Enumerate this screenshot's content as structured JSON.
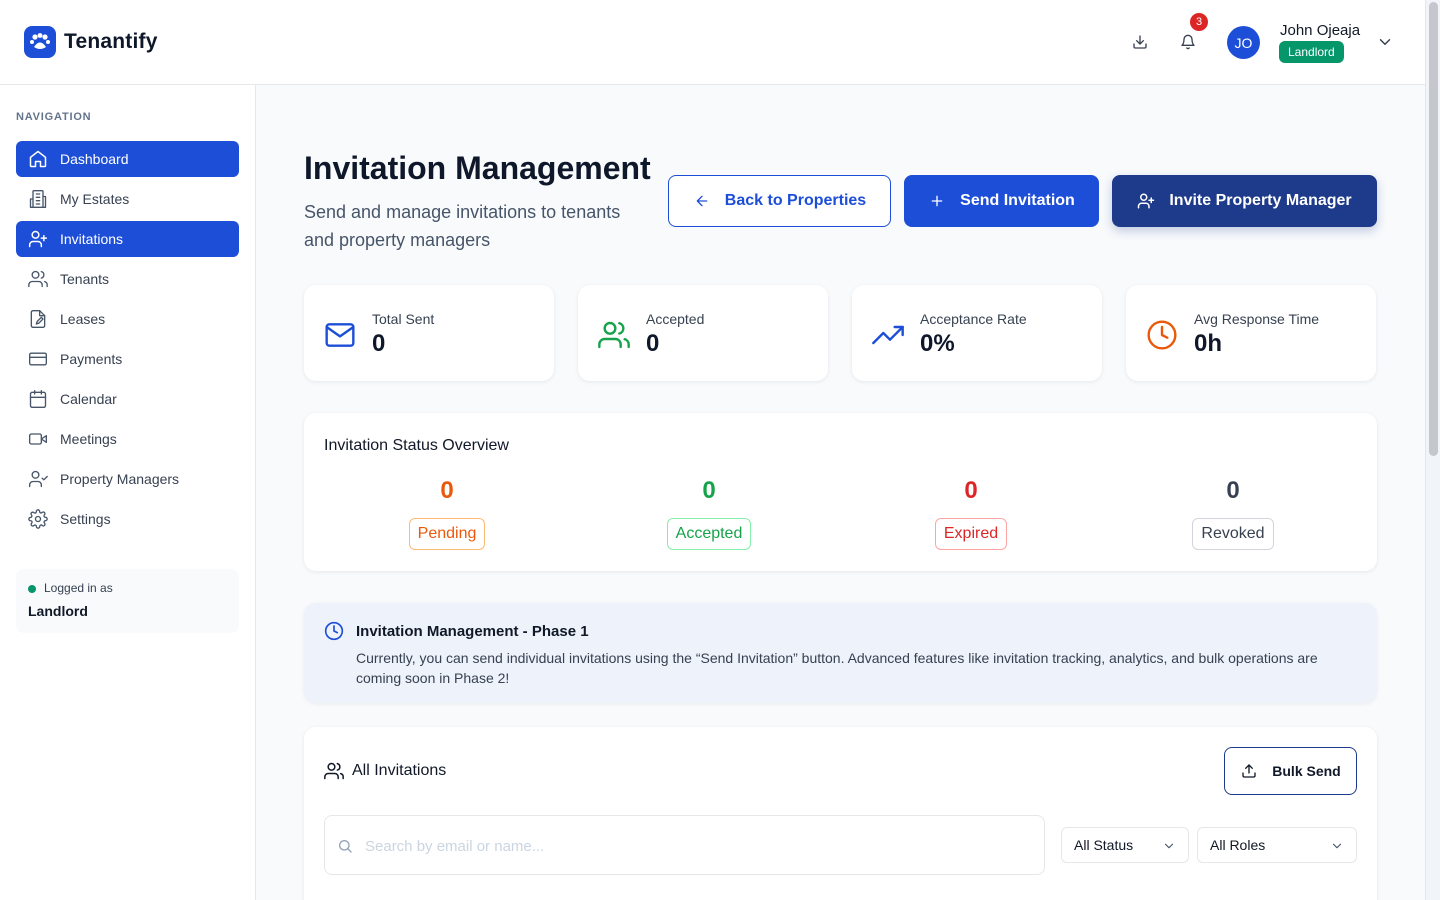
{
  "app": {
    "name": "Tenantify"
  },
  "header": {
    "notification_count": "3",
    "user": {
      "initials": "JO",
      "name": "John Ojeaja",
      "role": "Landlord"
    }
  },
  "sidebar": {
    "title": "NAVIGATION",
    "items": [
      {
        "label": "Dashboard",
        "icon": "home-icon",
        "active": true
      },
      {
        "label": "My Estates",
        "icon": "building-icon",
        "active": false
      },
      {
        "label": "Invitations",
        "icon": "user-plus-icon",
        "active": true
      },
      {
        "label": "Tenants",
        "icon": "users-icon",
        "active": false
      },
      {
        "label": "Leases",
        "icon": "file-edit-icon",
        "active": false
      },
      {
        "label": "Payments",
        "icon": "credit-card-icon",
        "active": false
      },
      {
        "label": "Calendar",
        "icon": "calendar-icon",
        "active": false
      },
      {
        "label": "Meetings",
        "icon": "video-icon",
        "active": false
      },
      {
        "label": "Property Managers",
        "icon": "user-check-icon",
        "active": false
      },
      {
        "label": "Settings",
        "icon": "gear-icon",
        "active": false
      }
    ],
    "login": {
      "label": "Logged in as",
      "role": "Landlord"
    }
  },
  "page": {
    "title": "Invitation Management",
    "subtitle": "Send and manage invitations to tenants and property managers",
    "buttons": {
      "back": "Back to Properties",
      "send": "Send Invitation",
      "invite_manager": "Invite Property Manager"
    }
  },
  "stats": [
    {
      "label": "Total Sent",
      "value": "0",
      "icon": "mail-icon",
      "color": "#1d4ed8"
    },
    {
      "label": "Accepted",
      "value": "0",
      "icon": "users-icon",
      "color": "#16a34a"
    },
    {
      "label": "Acceptance Rate",
      "value": "0%",
      "icon": "trending-up-icon",
      "color": "#1d4ed8"
    },
    {
      "label": "Avg Response Time",
      "value": "0h",
      "icon": "clock-icon",
      "color": "#ea580c"
    }
  ],
  "overview": {
    "title": "Invitation Status Overview",
    "statuses": [
      {
        "label": "Pending",
        "value": "0",
        "color": "#ea580c",
        "border": "#fdba74"
      },
      {
        "label": "Accepted",
        "value": "0",
        "color": "#16a34a",
        "border": "#86efac"
      },
      {
        "label": "Expired",
        "value": "0",
        "color": "#dc2626",
        "border": "#fca5a5"
      },
      {
        "label": "Revoked",
        "value": "0",
        "color": "#374151",
        "border": "#d1d5db"
      }
    ]
  },
  "notice": {
    "title": "Invitation Management - Phase 1",
    "body": "Currently, you can send individual invitations using the “Send Invitation” button. Advanced features like invitation tracking, analytics, and bulk operations are coming soon in Phase 2!"
  },
  "list": {
    "title": "All Invitations",
    "bulk_send": "Bulk Send",
    "search_placeholder": "Search by email or name...",
    "status_filter": "All Status",
    "role_filter": "All Roles"
  }
}
